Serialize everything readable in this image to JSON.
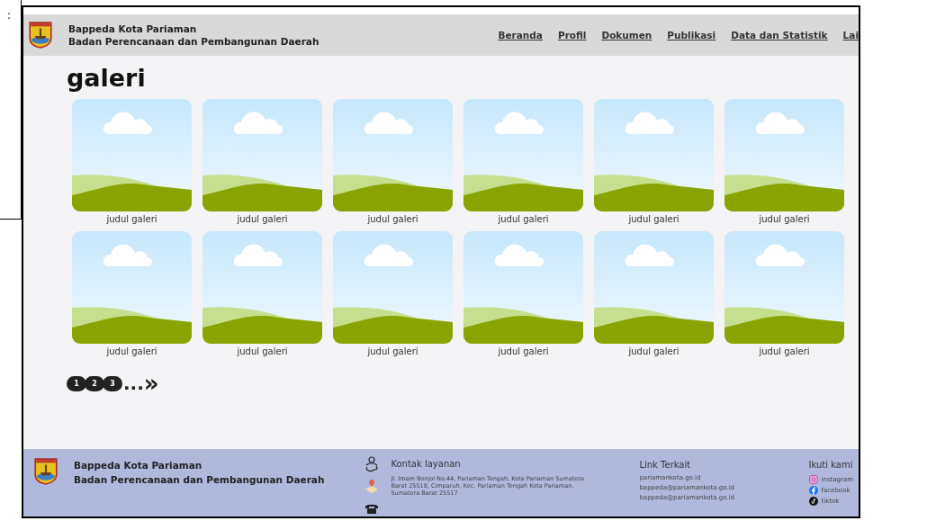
{
  "side_note": ":",
  "header": {
    "title": "Bappeda Kota Pariaman",
    "subtitle": "Badan Perencanaan dan Pembangunan Daerah",
    "nav": [
      "Beranda",
      "Profil",
      "Dokumen",
      "Publikasi",
      "Data dan Statistik",
      "Lai"
    ]
  },
  "page_title": "galeri",
  "gallery": [
    {
      "caption": "judul galeri"
    },
    {
      "caption": "judul galeri"
    },
    {
      "caption": "judul galeri"
    },
    {
      "caption": "judul galeri"
    },
    {
      "caption": "judul galeri"
    },
    {
      "caption": "judul galeri"
    },
    {
      "caption": "judul galeri"
    },
    {
      "caption": "judul galeri"
    },
    {
      "caption": "judul galeri"
    },
    {
      "caption": "judul galeri"
    },
    {
      "caption": "judul galeri"
    },
    {
      "caption": "judul galeri"
    }
  ],
  "pagination": {
    "pages": [
      "1",
      "2",
      "3"
    ],
    "ellipsis": "...",
    "next": "»"
  },
  "footer": {
    "title": "Bappeda Kota Pariaman",
    "subtitle": "Badan Perencanaan dan Pembangunan Daerah",
    "contact": {
      "heading": "Kontak layanan",
      "address": "Jl. Imam Bonjol No.44, Pariaman Tengah, Kota Pariaman Sumatera Barat 25518, Cimparuh, Kec. Pariaman Tengah Kota Pariaman, Sumatera Barat 25517"
    },
    "links": {
      "heading": "Link Terkait",
      "items": [
        "pariamankota.go.id",
        "bappeda@pariamankota.go.id",
        "bappeda@pariamankota.go.id"
      ]
    },
    "social": {
      "heading": "Ikuti kami",
      "items": [
        {
          "kind": "instagram",
          "label": "instagram"
        },
        {
          "kind": "facebook",
          "label": "facebook"
        },
        {
          "kind": "tiktok",
          "label": "tiktok"
        }
      ]
    }
  }
}
